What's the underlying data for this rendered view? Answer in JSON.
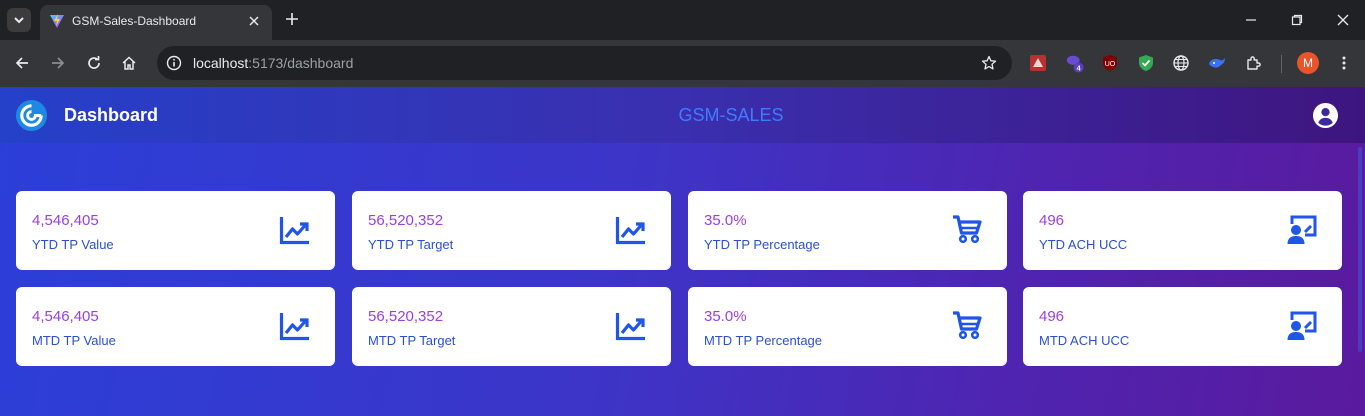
{
  "browser": {
    "tab_title": "GSM-Sales-Dashboard",
    "url_host": "localhost",
    "url_path": ":5173/dashboard",
    "extension_badge": "4",
    "profile_initial": "M"
  },
  "header": {
    "title": "Dashboard",
    "brand": "GSM-SALES"
  },
  "cards": [
    {
      "value": "4,546,405",
      "label": "YTD TP Value",
      "icon": "trending-up-icon"
    },
    {
      "value": "56,520,352",
      "label": "YTD TP Target",
      "icon": "trending-up-icon"
    },
    {
      "value": "35.0%",
      "label": "YTD TP Percentage",
      "icon": "cart-icon"
    },
    {
      "value": "496",
      "label": "YTD ACH UCC",
      "icon": "presenter-icon"
    },
    {
      "value": "4,546,405",
      "label": "MTD TP Value",
      "icon": "trending-up-icon"
    },
    {
      "value": "56,520,352",
      "label": "MTD TP Target",
      "icon": "trending-up-icon"
    },
    {
      "value": "35.0%",
      "label": "MTD TP Percentage",
      "icon": "cart-icon"
    },
    {
      "value": "496",
      "label": "MTD ACH UCC",
      "icon": "presenter-icon"
    }
  ],
  "colors": {
    "value": "#9c3fe0",
    "label": "#2a4fd6",
    "icon": "#1f55e8",
    "brand": "#3f7bff"
  }
}
